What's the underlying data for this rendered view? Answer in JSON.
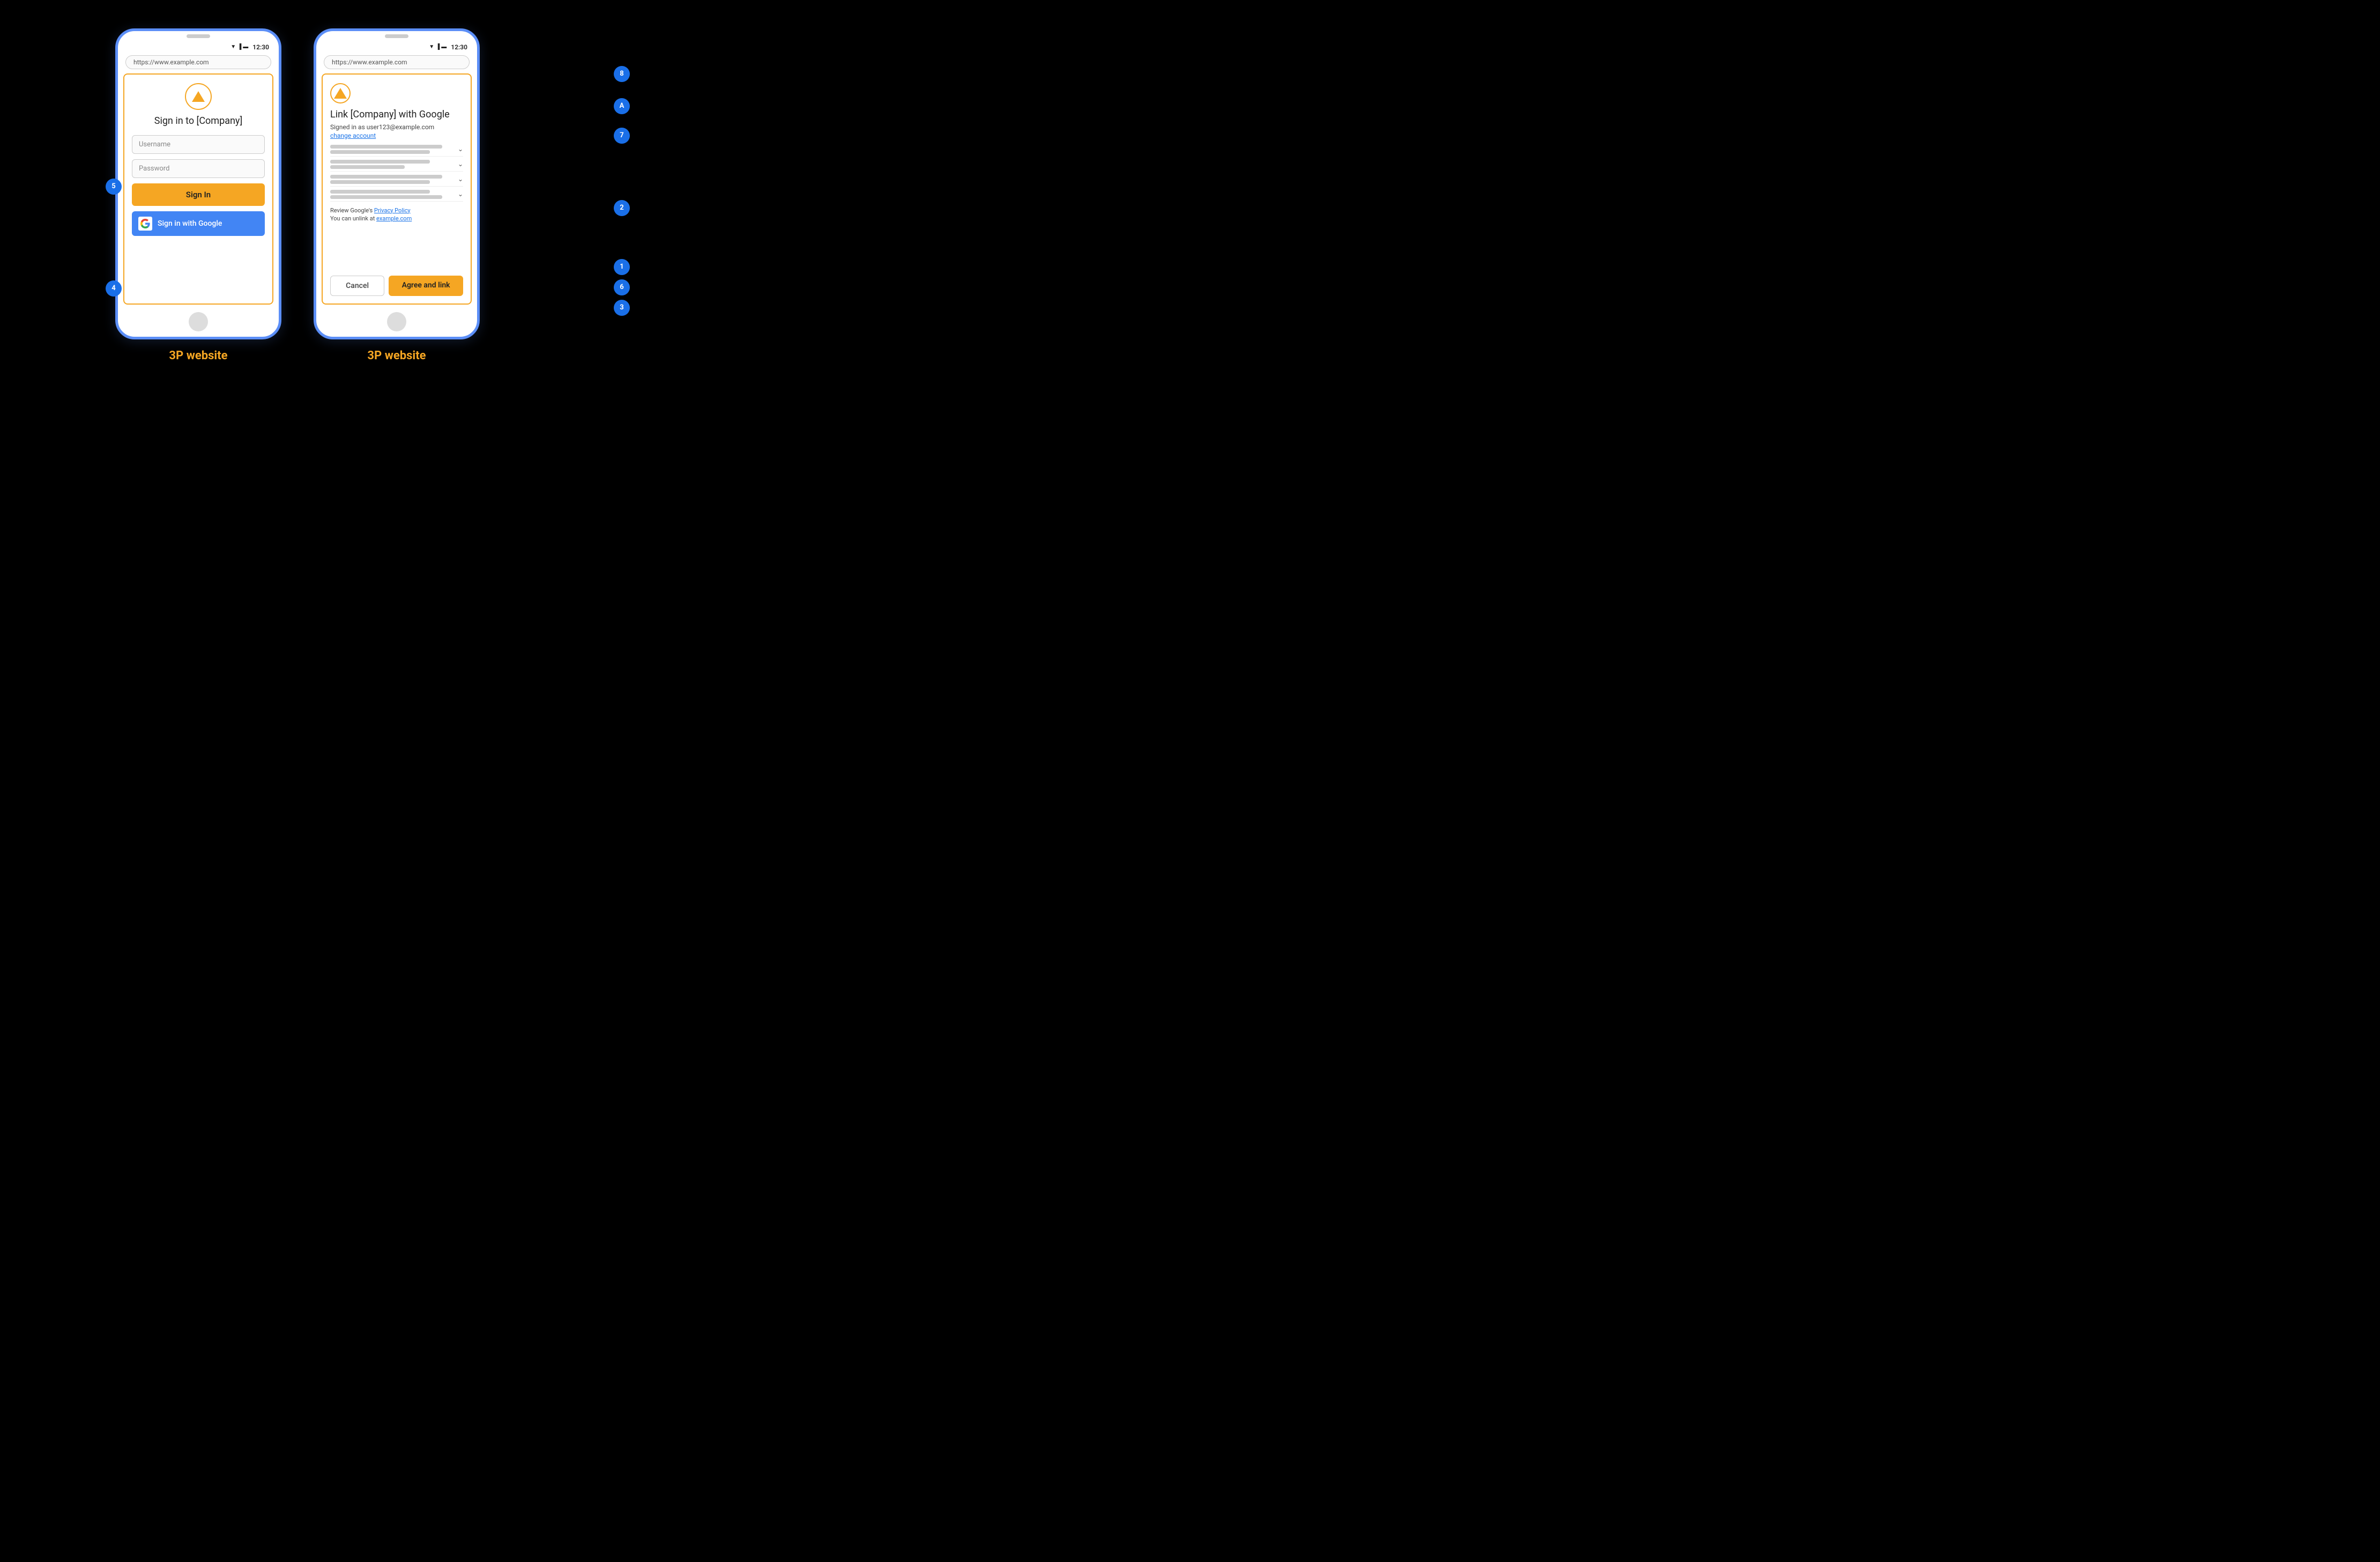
{
  "page": {
    "background": "#000000"
  },
  "left_phone": {
    "label": "3P website",
    "status_bar": {
      "time": "12:30",
      "icons": [
        "wifi",
        "signal",
        "battery"
      ]
    },
    "address_bar": "https://www.example.com",
    "company_logo_alt": "Company logo triangle",
    "sign_in_title": "Sign in to [Company]",
    "username_placeholder": "Username",
    "password_placeholder": "Password",
    "sign_in_button": "Sign In",
    "google_sign_in_button": "Sign in with Google"
  },
  "right_phone": {
    "label": "3P website",
    "status_bar": {
      "time": "12:30",
      "icons": [
        "wifi",
        "signal",
        "battery"
      ]
    },
    "address_bar": "https://www.example.com",
    "company_logo_alt": "Company logo triangle",
    "link_title": "Link [Company] with Google",
    "signed_in_as": "Signed in as user123@example.com",
    "change_account": "change account",
    "privacy_text_prefix": "Review Google's ",
    "privacy_link": "Privacy Policy",
    "unlink_text_prefix": "You can unlink at ",
    "unlink_link": "example.com",
    "cancel_button": "Cancel",
    "agree_button": "Agree and link"
  },
  "badges": {
    "b1": "1",
    "b2": "2",
    "b3": "3",
    "b4": "4",
    "b5": "5",
    "b6": "6",
    "b7": "7",
    "b8": "8",
    "bA": "A"
  }
}
